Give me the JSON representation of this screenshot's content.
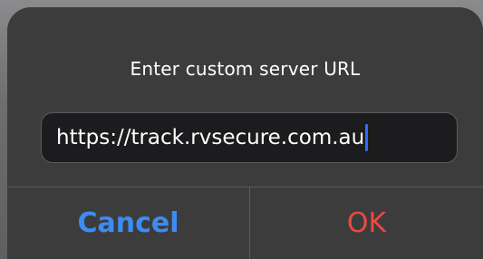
{
  "alert": {
    "title": "Enter custom server URL",
    "input": {
      "value": "https://track.rvsecure.com.au"
    },
    "buttons": {
      "cancel_label": "Cancel",
      "ok_label": "OK"
    }
  },
  "colors": {
    "alert_background": "#3c3c3d",
    "field_background": "#1c1c1e",
    "cancel_text": "#3d8cf5",
    "ok_text": "#ec4a3f",
    "caret": "#2f6cff"
  }
}
